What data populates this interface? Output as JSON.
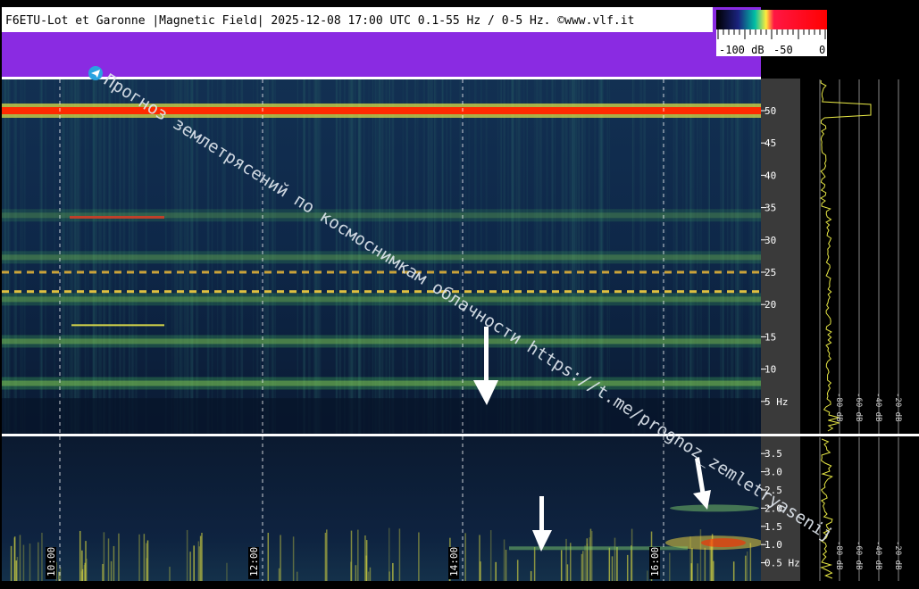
{
  "header": {
    "title": "F6ETU-Lot et Garonne |Magnetic Field| 2025-12-08 17:00 UTC 0.1-55 Hz / 0-5 Hz. ©www.vlf.it"
  },
  "colorbar": {
    "labels": [
      "-100 dB",
      "-50",
      "0"
    ]
  },
  "watermark": {
    "text": "Прогноз землетрясений по космоснимкам облачности  https://t.me/prognoz_zemletryasenij"
  },
  "colors": {
    "background": "#0d1b33",
    "header_band": "#8a2be2",
    "line_50hz": "#ff2a00",
    "trace": "#e8e845",
    "axis_text": "#ffffff"
  },
  "chart_data": [
    {
      "type": "heatmap",
      "title": "F6ETU-Lot et Garonne |Magnetic Field|",
      "subtitle": "2025-12-08 17:00 UTC 0.1-55 Hz",
      "xlabel": "",
      "ylabel": "Hz",
      "x_ticks": [
        "10:00",
        "12:00",
        "14:00",
        "16:00"
      ],
      "y_ticks": [
        5,
        10,
        15,
        20,
        25,
        30,
        35,
        40,
        45,
        50
      ],
      "y_tick_labels": [
        "5 Hz",
        "10",
        "15",
        "20",
        "25",
        "30",
        "35",
        "40",
        "45",
        "50"
      ],
      "ylim": [
        0,
        55
      ],
      "bands_hz": [
        7.8,
        14.3,
        20.8,
        27.3,
        33.8
      ],
      "power_line_hz": 50,
      "spectrum_axis_labels": [
        "-80 dB",
        "-60 dB",
        "-40 dB",
        "-20 dB"
      ]
    },
    {
      "type": "heatmap",
      "title": "",
      "subtitle": "0-5 Hz",
      "ylabel": "Hz",
      "x_ticks": [
        "10:00",
        "12:00",
        "14:00",
        "16:00"
      ],
      "y_ticks": [
        0.5,
        1.0,
        1.5,
        2.0,
        2.5,
        3.0,
        3.5
      ],
      "y_tick_labels": [
        "0.5 Hz",
        "1.0",
        "1.5",
        "2.0",
        "2.5",
        "3.0",
        "3.5"
      ],
      "ylim": [
        0,
        4
      ],
      "spectrum_axis_labels": [
        "-80 dB",
        "-60 dB",
        "-40 dB",
        "-20 dB"
      ]
    }
  ]
}
